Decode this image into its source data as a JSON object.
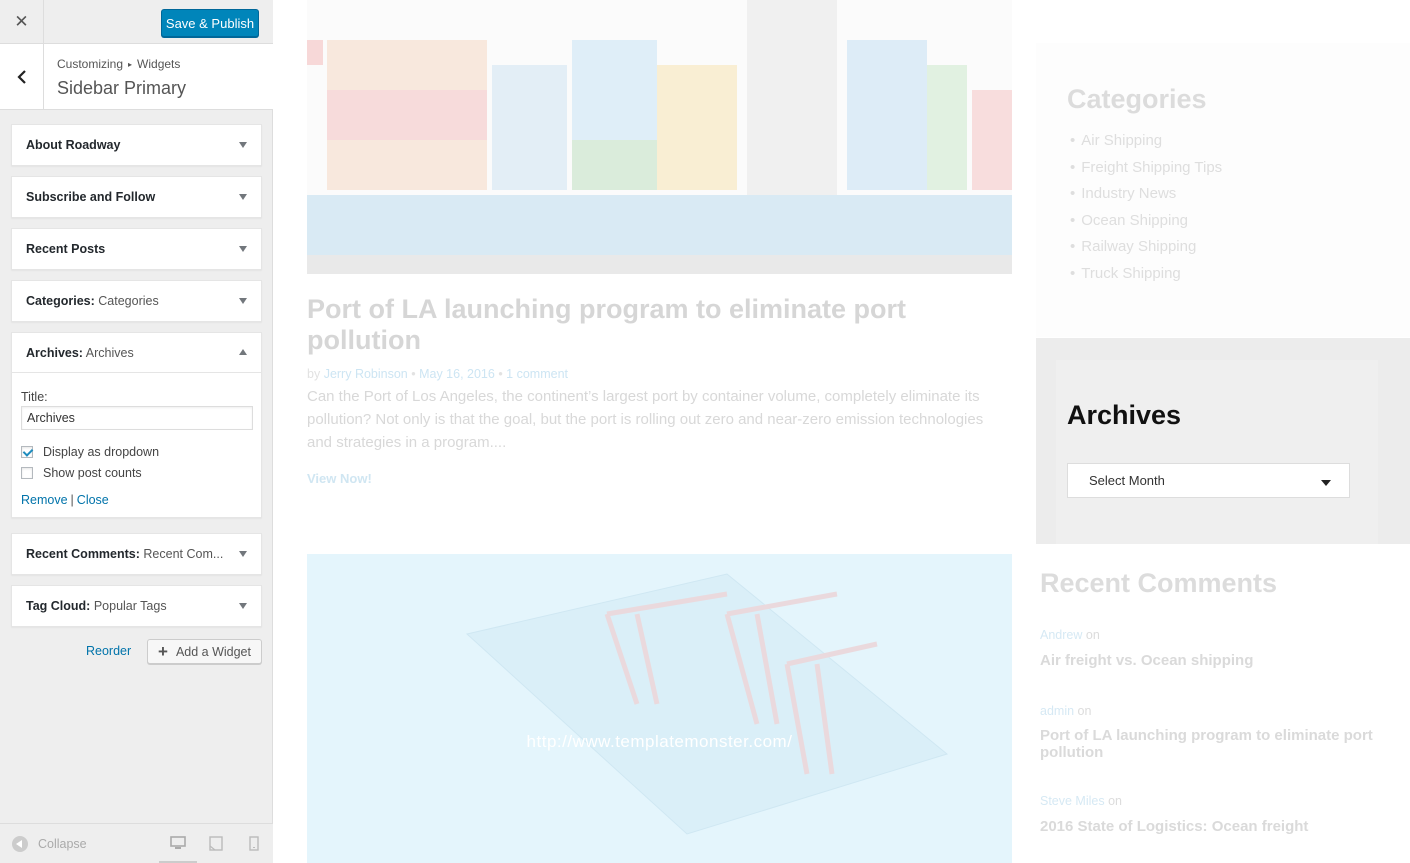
{
  "topbar": {
    "close_glyph": "✕",
    "save_label": "Save & Publish"
  },
  "section": {
    "breadcrumb_root": "Customizing",
    "breadcrumb_sep": "▸",
    "breadcrumb_leaf": "Widgets",
    "title": "Sidebar Primary"
  },
  "widgets": [
    {
      "name": "About Roadway",
      "sub": ""
    },
    {
      "name": "Subscribe and Follow",
      "sub": ""
    },
    {
      "name": "Recent Posts",
      "sub": ""
    },
    {
      "name": "Categories:",
      "sub": "Categories"
    },
    {
      "name": "Archives:",
      "sub": "Archives"
    },
    {
      "name": "Recent Comments:",
      "sub": "Recent Com..."
    },
    {
      "name": "Tag Cloud:",
      "sub": "Popular Tags"
    }
  ],
  "archives_form": {
    "title_label": "Title:",
    "title_value": "Archives",
    "dropdown_label": "Display as dropdown",
    "dropdown_checked": true,
    "counts_label": "Show post counts",
    "counts_checked": false,
    "remove_label": "Remove",
    "separator": "|",
    "close_label": "Close"
  },
  "panel_actions": {
    "reorder_label": "Reorder",
    "add_widget_label": "Add a Widget"
  },
  "footer": {
    "collapse_label": "Collapse"
  },
  "preview": {
    "post": {
      "title": "Port of LA launching program to eliminate port pollution",
      "meta_by": "by",
      "author": "Jerry Robinson",
      "date": "May 16, 2016",
      "comments": "1 comment",
      "excerpt": "Can the Port of Los Angeles, the continent’s largest port by container volume, completely eliminate its pollution? Not only is that the goal, but the port is rolling out zero and near-zero emission technologies and strategies in a program....",
      "view_label": "View Now!",
      "image_url_text": "http://www.templatemonster.com/"
    },
    "categories": {
      "title": "Categories",
      "items": [
        "Air Shipping",
        "Freight Shipping Tips",
        "Industry News",
        "Ocean Shipping",
        "Railway Shipping",
        "Truck Shipping"
      ]
    },
    "archives": {
      "title": "Archives",
      "select_value": "Select Month"
    },
    "recent_comments": {
      "title": "Recent Comments",
      "on_word": "on",
      "items": [
        {
          "author": "Andrew",
          "post": "Air freight vs. Ocean shipping"
        },
        {
          "author": "admin",
          "post": "Port of LA launching program to eliminate port pollution"
        },
        {
          "author": "Steve Miles",
          "post": "2016 State of Logistics: Ocean freight"
        }
      ]
    }
  },
  "colors": {
    "primary_button": "#0085ba",
    "link": "#0073aa",
    "panel_bg": "#eeeeee"
  }
}
